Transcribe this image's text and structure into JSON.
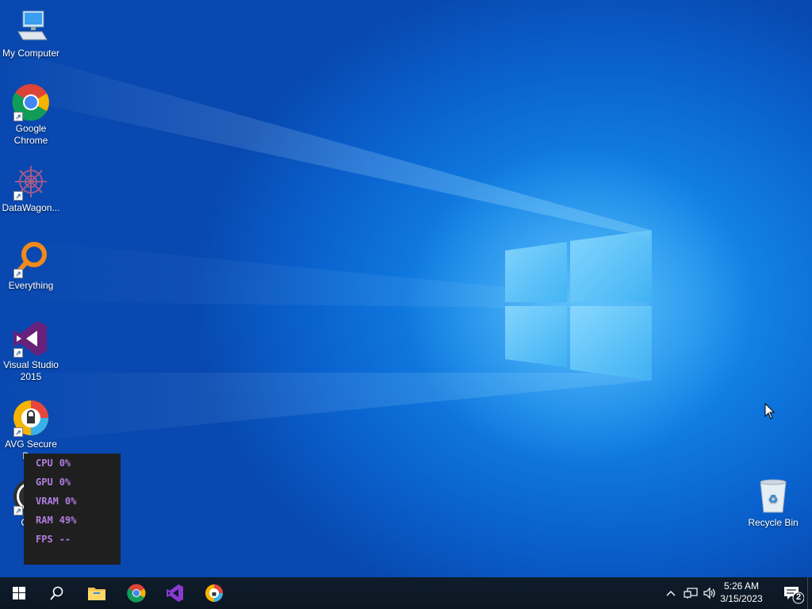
{
  "desktop": {
    "icons": [
      {
        "label": "My Computer",
        "icon": "computer-icon"
      },
      {
        "label": "Google Chrome",
        "icon": "chrome-icon"
      },
      {
        "label": "DataWagon...",
        "icon": "datawagon-icon"
      },
      {
        "label": "Everything",
        "icon": "everything-search-icon"
      },
      {
        "label": "Visual Studio 2015",
        "icon": "visual-studio-icon"
      },
      {
        "label": "AVG Secure Br...",
        "icon": "avg-browser-icon"
      },
      {
        "label": "OBS",
        "icon": "obs-icon"
      }
    ],
    "recycle_bin": {
      "label": "Recycle Bin",
      "icon": "recycle-bin-icon"
    }
  },
  "perf_overlay": {
    "rows": [
      {
        "label": "CPU",
        "value": "0%"
      },
      {
        "label": "GPU",
        "value": "0%"
      },
      {
        "label": "VRAM",
        "value": "0%"
      },
      {
        "label": "RAM",
        "value": "49%"
      },
      {
        "label": "FPS",
        "value": "--"
      }
    ],
    "text_color": "#b07ee0"
  },
  "taskbar": {
    "pinned": [
      "start-icon",
      "search-icon",
      "file-explorer-icon",
      "chrome-icon",
      "visual-studio-icon",
      "avg-browser-icon"
    ],
    "clock": {
      "time": "5:26 AM",
      "date": "3/15/2023"
    },
    "notification_count": "2"
  },
  "colors": {
    "accent": "#1283e6",
    "taskbar": "#0d1b2b"
  }
}
